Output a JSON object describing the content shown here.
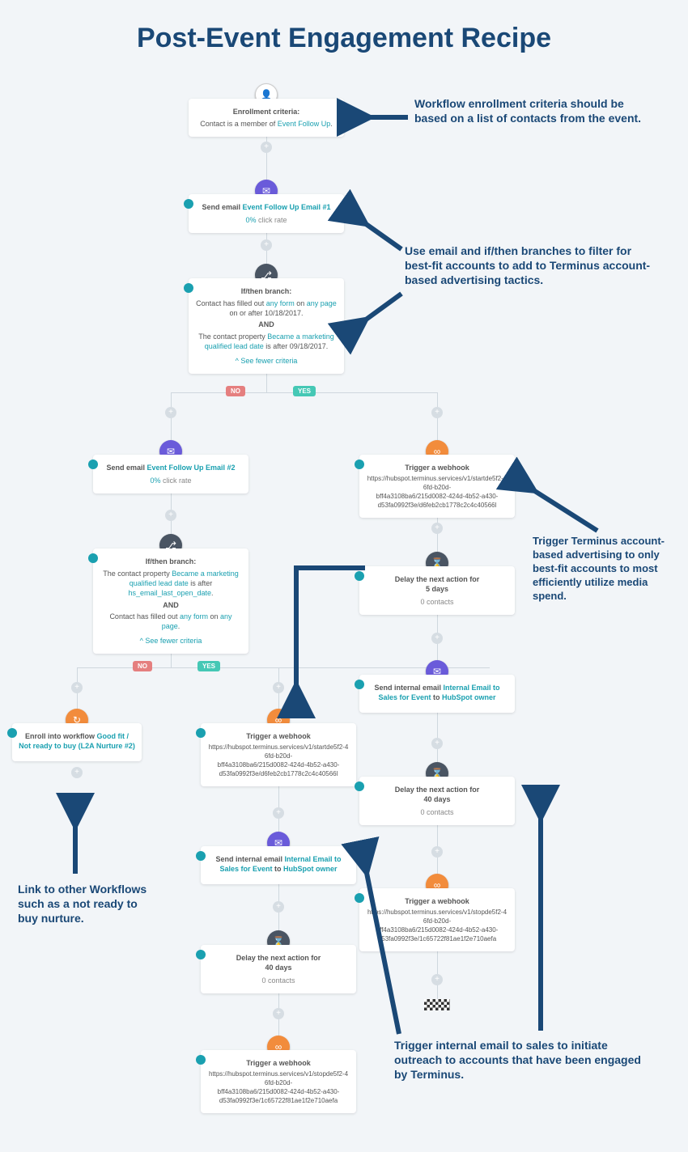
{
  "title": "Post-Event Engagement Recipe",
  "annotations": {
    "a1": "Workflow enrollment criteria should be based on a list of contacts from the event.",
    "a2": "Use email and if/then branches to filter for best-fit accounts to add to Terminus account-based advertising tactics.",
    "a3": "Trigger Terminus account-based advertising to only best-fit accounts to most efficiently utilize media spend.",
    "a4": "Link to other Workflows such as a not ready to buy nurture.",
    "a5": "Trigger internal email to sales to initiate outreach to accounts that have been engaged by Terminus."
  },
  "labels": {
    "no": "NO",
    "yes": "YES"
  },
  "enroll": {
    "hdr": "Enrollment criteria:",
    "text_pre": "Contact is a member of ",
    "link": "Event Follow Up",
    "text_post": "."
  },
  "email1": {
    "hdr_pre": "Send email ",
    "link": "Event Follow Up Email #1",
    "rate_pct": "0%",
    "rate_lbl": " click rate"
  },
  "branch1": {
    "hdr": "If/then branch:",
    "l1_pre": "Contact has filled out ",
    "l1_t": "any form",
    "l1_mid": " on ",
    "l1_t2": "any page",
    "l1_post": " on or after 10/18/2017.",
    "and": "AND",
    "l2_pre": "The contact property ",
    "l2_link": "Became a marketing qualified lead date",
    "l2_post": " is after 09/18/2017.",
    "see": "^ See fewer criteria"
  },
  "email2": {
    "hdr_pre": "Send email ",
    "link": "Event Follow Up Email #2",
    "rate_pct": "0%",
    "rate_lbl": " click rate"
  },
  "branch2": {
    "hdr": "If/then branch:",
    "l1_pre": "The contact property ",
    "l1_link": "Became a marketing qualified lead date",
    "l1_mid": " is after ",
    "l1_link2": "hs_email_last_open_date",
    "l1_post": ".",
    "and": "AND",
    "l2_pre": "Contact has filled out ",
    "l2_t": "any form",
    "l2_mid": " on ",
    "l2_t2": "any page",
    "l2_post": ".",
    "see": "^ See fewer criteria"
  },
  "enrollwf": {
    "hdr_pre": "Enroll into workflow ",
    "link": "Good fit / Not ready to buy (L2A Nurture #2)"
  },
  "webhook_start": {
    "hdr": "Trigger a webhook",
    "u1": "https://hubspot.terminus.services/v1/startde5f2-46fd-b20d-",
    "u2": "bff4a3108ba6/215d0082-424d-4b52-a430-",
    "u3": "d53fa0992f3e/d6feb2cb1778c2c4c40566l"
  },
  "webhook_stop": {
    "hdr": "Trigger a webhook",
    "u1": "https://hubspot.terminus.services/v1/stopde5f2-46fd-b20d-",
    "u2": "bff4a3108ba6/215d0082-424d-4b52-a430-",
    "u3": "d53fa0992f3e/1c65722f81ae1f2e710aefa"
  },
  "internal": {
    "hdr_pre": "Send internal email ",
    "link": "Internal Email to Sales for Event",
    "hdr_mid": " to ",
    "link2": "HubSpot owner"
  },
  "delay5": {
    "line1": "Delay the next action for",
    "line2": "5 days",
    "contacts": "0 contacts"
  },
  "delay40": {
    "line1": "Delay the next action for",
    "line2": "40 days",
    "contacts": "0 contacts"
  }
}
